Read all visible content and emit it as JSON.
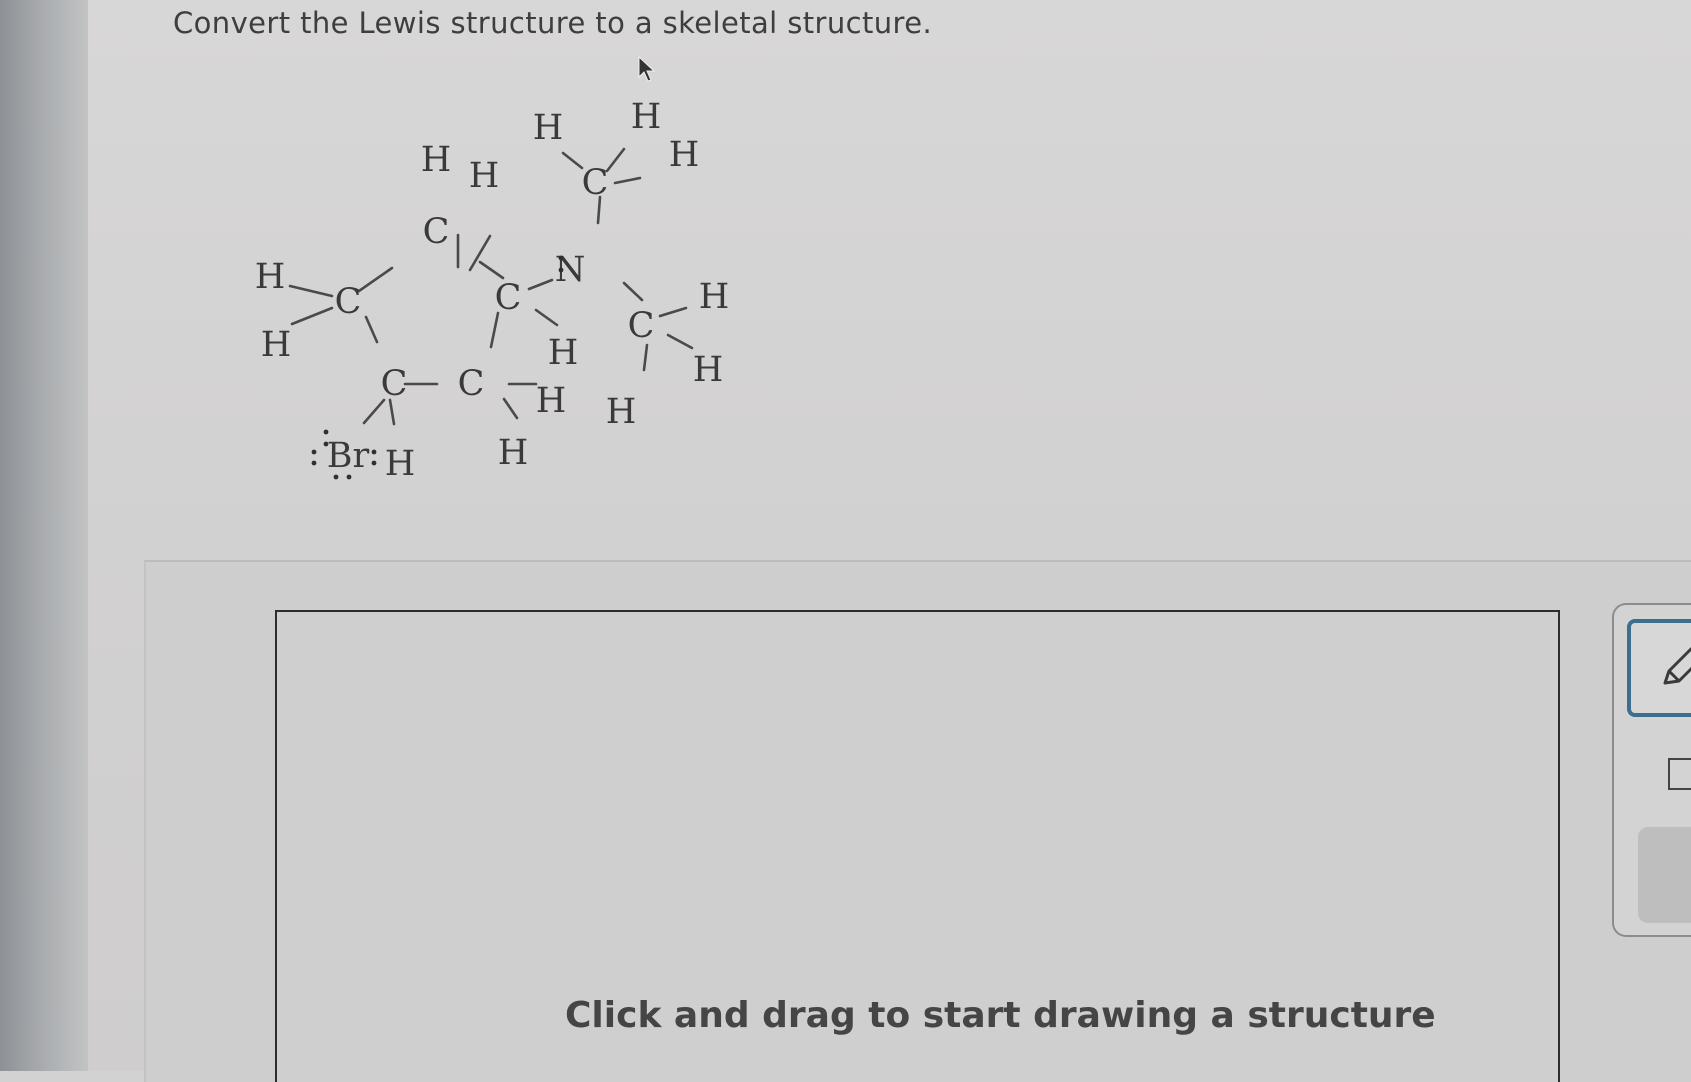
{
  "question": {
    "prompt": "Convert the Lewis structure to a skeletal structure."
  },
  "lewis_structure": {
    "atoms": [
      "H",
      "H",
      "C",
      "H",
      "H",
      "C",
      "C",
      "H",
      "H",
      "C",
      "C",
      "H",
      "H",
      "C",
      "H",
      "H",
      "N",
      "C",
      "H",
      "H",
      "H",
      "Br",
      "H"
    ],
    "lone_pair_symbol": ":",
    "bromine_label": "Br"
  },
  "canvas": {
    "hint": "Click and drag to start drawing a structure"
  },
  "toolbar": {
    "tools": [
      "pencil-icon",
      "eraser-icon",
      "tool-panel"
    ],
    "accent_color": "#3b6f8c"
  }
}
